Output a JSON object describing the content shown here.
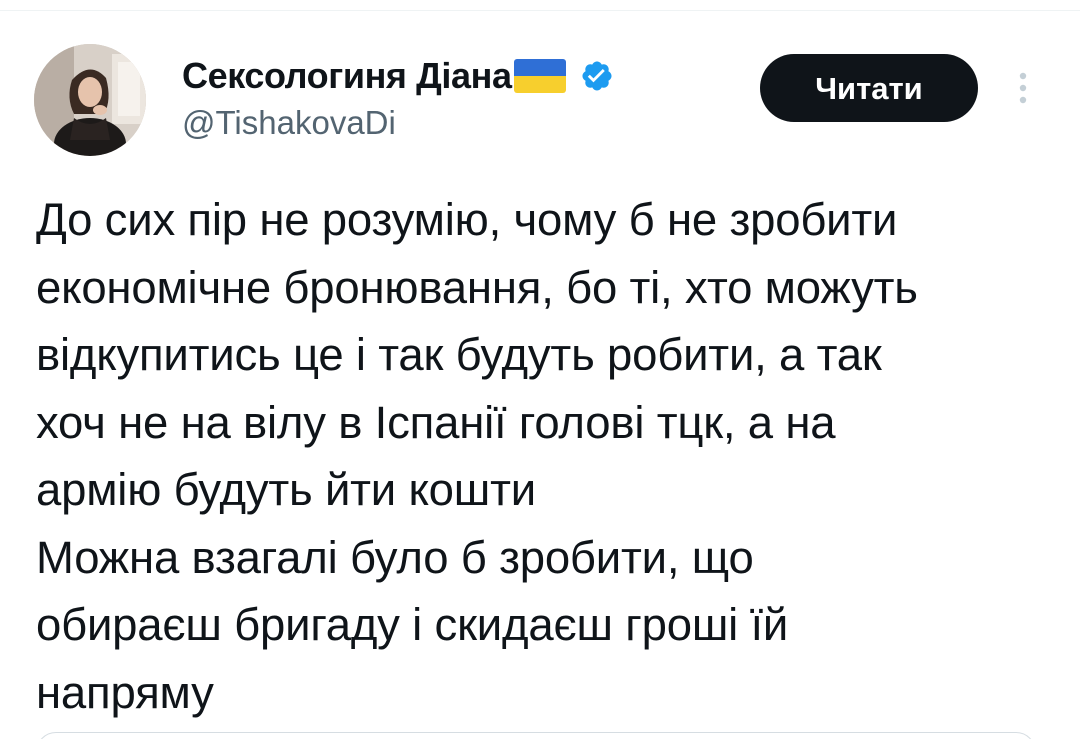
{
  "tweet": {
    "author": {
      "display_name": "Сексологиня Діана",
      "handle": "@TishakovaDi",
      "avatar_icon": "user-photo",
      "verified": true,
      "flag": "ukraine-flag"
    },
    "follow_button_label": "Читати",
    "more_icon": "vertical-ellipsis-icon",
    "text_lines": [
      "До сих пір не розумію, чому б не зробити",
      "економічне бронювання, бо ті, хто можуть",
      "відкупитись це і так будуть робити, а так",
      "хоч не на вілу в Іспанії голові тцк, а на",
      "армію будуть йти кошти",
      "Можна взагалі було б зробити, що",
      "обираєш бригаду і скидаєш гроші їй",
      "напряму"
    ]
  },
  "colors": {
    "text_primary": "#0f1419",
    "text_secondary": "#536471",
    "verified_blue": "#1d9bf0",
    "button_bg": "#0f1419",
    "flag_blue": "#2f6fd6",
    "flag_yellow": "#f7cf2d"
  }
}
